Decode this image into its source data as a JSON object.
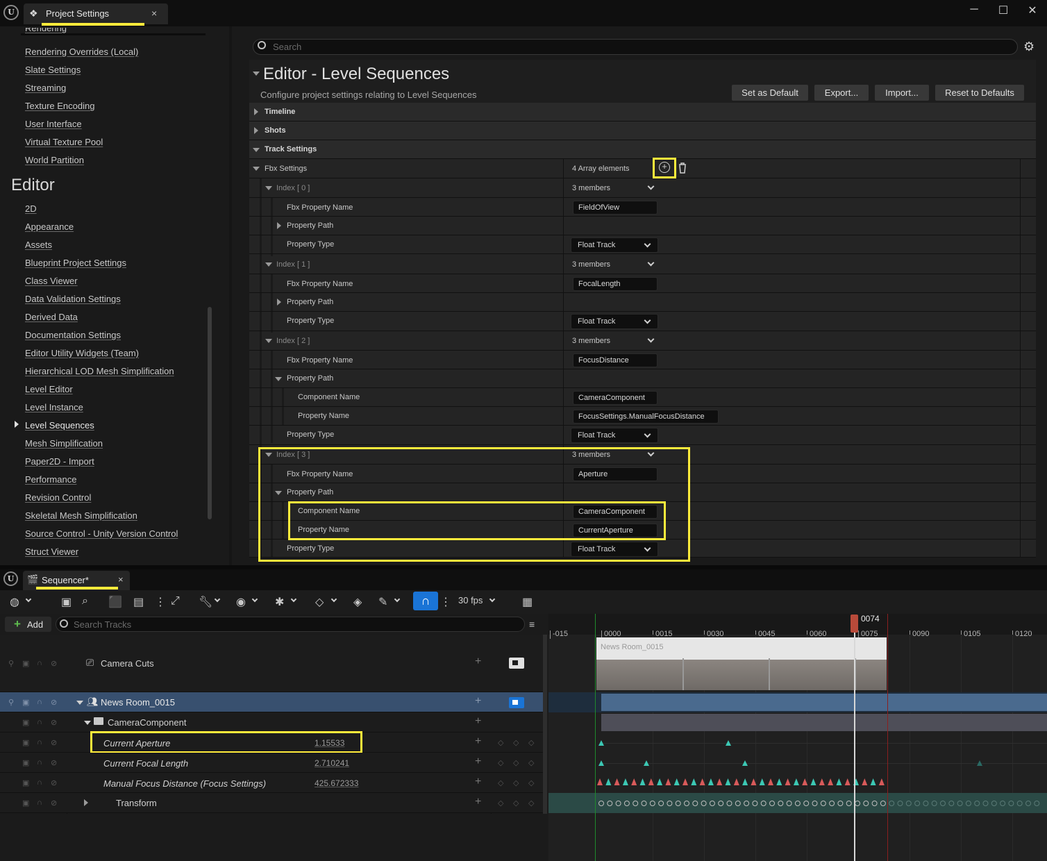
{
  "window": {
    "tab_title": "Project Settings",
    "tab_close": "×",
    "controls": {
      "minimize": "─",
      "maximize": "☐",
      "close": "✕"
    }
  },
  "left_nav": {
    "clipped_item": "Rendering",
    "items_top": [
      "Rendering Overrides (Local)",
      "Slate Settings",
      "Streaming",
      "Texture Encoding",
      "User Interface",
      "Virtual Texture Pool",
      "World Partition"
    ],
    "section": "Editor",
    "items_editor": [
      "2D",
      "Appearance",
      "Assets",
      "Blueprint Project Settings",
      "Class Viewer",
      "Data Validation Settings",
      "Derived Data",
      "Documentation Settings",
      "Editor Utility Widgets (Team)",
      "Hierarchical LOD Mesh Simplification",
      "Level Editor",
      "Level Instance",
      "Level Sequences",
      "Mesh Simplification",
      "Paper2D - Import",
      "Performance",
      "Revision Control",
      "Skeletal Mesh Simplification",
      "Source Control - Unity Version Control",
      "Struct Viewer"
    ],
    "selected": "Level Sequences"
  },
  "settings": {
    "search_placeholder": "Search",
    "title": "Editor - Level Sequences",
    "subtitle": "Configure project settings relating to Level Sequences",
    "buttons": {
      "set_default": "Set as Default",
      "export": "Export...",
      "import": "Import...",
      "reset": "Reset to Defaults"
    },
    "categories": {
      "timeline": "Timeline",
      "shots": "Shots",
      "track_settings": "Track Settings"
    },
    "fbx_settings": {
      "label": "Fbx Settings",
      "value": "4 Array elements"
    },
    "labels": {
      "fbx_property_name": "Fbx Property Name",
      "property_path": "Property Path",
      "property_type": "Property Type",
      "component_name": "Component Name",
      "property_name": "Property Name",
      "members": "3 members",
      "float_track": "Float Track"
    },
    "indices": [
      {
        "label": "Index [ 0 ]",
        "fbx_name": "FieldOfView"
      },
      {
        "label": "Index [ 1 ]",
        "fbx_name": "FocalLength"
      },
      {
        "label": "Index [ 2 ]",
        "fbx_name": "FocusDistance",
        "component": "CameraComponent",
        "property": "FocusSettings.ManualFocusDistance"
      },
      {
        "label": "Index [ 3 ]",
        "fbx_name": "Aperture",
        "component": "CameraComponent",
        "property": "CurrentAperture"
      }
    ]
  },
  "sequencer": {
    "tab_title": "Sequencer*",
    "fps": "30 fps",
    "add_label": "Add",
    "search_placeholder": "Search Tracks",
    "current_frame": "0074",
    "ruler_ticks": [
      "-015",
      "0000",
      "0015",
      "0030",
      "0045",
      "0060",
      "0075",
      "0090",
      "0105",
      "0120"
    ],
    "tracks": {
      "camera_cuts": "Camera Cuts",
      "news_room": "News Room_0015",
      "camera_component": "CameraComponent",
      "current_aperture": {
        "name": "Current Aperture",
        "value": "1.15533"
      },
      "focal_length": {
        "name": "Current Focal Length",
        "value": "2.710241"
      },
      "focus_distance": {
        "name": "Manual Focus Distance (Focus Settings)",
        "value": "425.672333"
      },
      "transform": "Transform"
    },
    "thumbnail_label": "News Room_0015"
  }
}
